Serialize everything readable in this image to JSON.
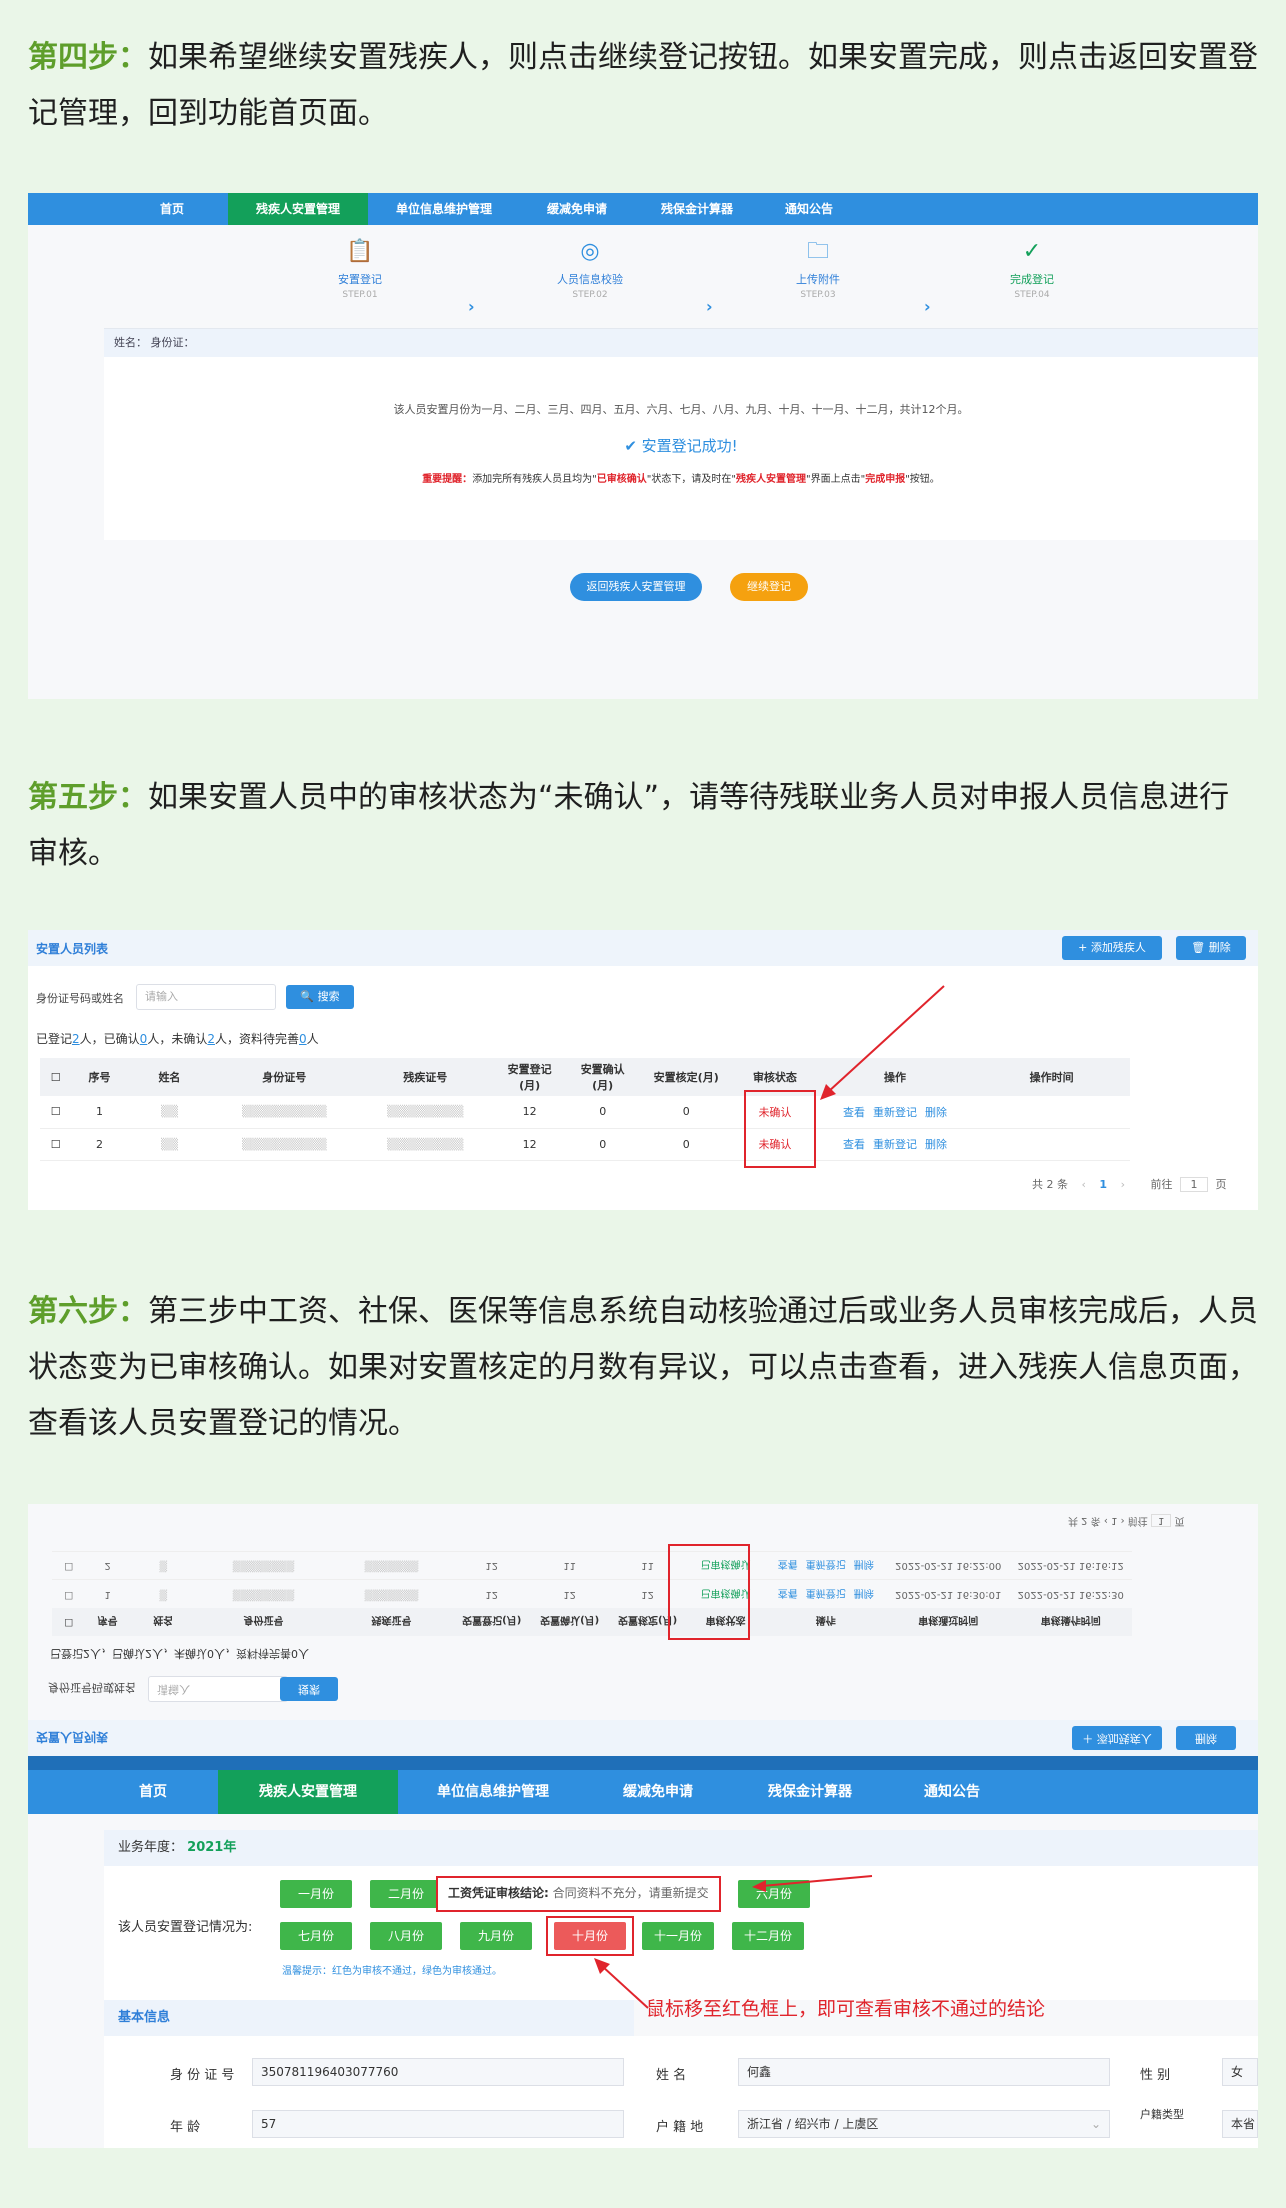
{
  "step4": {
    "label": "第四步：",
    "text": "如果希望继续安置残疾人，则点击继续登记按钮。如果安置完成，则点击返回安置登记管理，回到功能首页面。"
  },
  "nav": [
    "首页",
    "残疾人安置管理",
    "单位信息维护管理",
    "缓减免申请",
    "残保金计算器",
    "通知公告"
  ],
  "wizard": [
    {
      "name": "安置登记",
      "sub": "STEP.01",
      "icon": "clipboard-icon"
    },
    {
      "name": "人员信息校验",
      "sub": "STEP.02",
      "icon": "verify-icon"
    },
    {
      "name": "上传附件",
      "sub": "STEP.03",
      "icon": "upload-folder-icon"
    },
    {
      "name": "完成登记",
      "sub": "STEP.04",
      "icon": "check-circle-icon"
    }
  ],
  "success_card": {
    "person_header": "姓名：        身份证：",
    "months_msg": "该人员安置月份为一月、二月、三月、四月、五月、六月、七月、八月、九月、十月、十一月、十二月，共计12个月。",
    "success": "安置登记成功!",
    "warn_prefix": "重要提醒：",
    "warn_a": "添加完所有残疾人员且均为\"",
    "warn_b": "已审核确认",
    "warn_c": "\"状态下，请及时在\"",
    "warn_d": "残疾人安置管理",
    "warn_e": "\"界面上点击\"",
    "warn_f": "完成申报",
    "warn_g": "\"按钮。"
  },
  "buttons": {
    "back": "返回残疾人安置管理",
    "continue": "继续登记"
  },
  "step5": {
    "label": "第五步：",
    "text": "如果安置人员中的审核状态为“未确认”，请等待残联业务人员对申报人员信息进行审核。"
  },
  "list": {
    "title": "安置人员列表",
    "add": "+ 添加残疾人",
    "delete": "🗑 删除",
    "search_label": "身份证号码或姓名",
    "search_placeholder": "请输入",
    "search_btn": "🔍 搜索",
    "summary": {
      "a": "已登记",
      "registered": "2",
      "b": "人，已确认",
      "confirmed": "0",
      "c": "人，未确认",
      "unconfirmed": "2",
      "d": "人，资料待完善",
      "pending": "0",
      "e": "人"
    },
    "columns": [
      "序号",
      "姓名",
      "身份证号",
      "残疾证号",
      "安置登记\n(月)",
      "安置确认\n(月)",
      "安置核定(月)",
      "审核状态",
      "操作",
      "操作时间"
    ],
    "rows": [
      {
        "no": "1",
        "reg": "12",
        "conf": "0",
        "appr": "0",
        "status": "未确认"
      },
      {
        "no": "2",
        "reg": "12",
        "conf": "0",
        "appr": "0",
        "status": "未确认"
      }
    ],
    "ops": [
      "查看",
      "重新登记",
      "删除"
    ],
    "pager": {
      "total": "共 2 条",
      "page": "1",
      "goto": "前往",
      "pageinput": "1",
      "unit": "页"
    }
  },
  "step6": {
    "label": "第六步：",
    "text": "第三步中工资、社保、医保等信息系统自动核验通过后或业务人员审核完成后，人员状态变为已审核确认。如果对安置核定的月数有异议，可以点击查看，进入残疾人信息页面，查看该人员安置登记的情况。"
  },
  "flipped": {
    "title": "安置人员列表",
    "summary": "已登记2人，已确认2人，未确认0人，资料待完善0人",
    "search_label": "身份证号码或姓名",
    "rows": [
      {
        "no": "1",
        "reg": "12",
        "conf": "12",
        "appr": "12",
        "status": "已审核确认",
        "t1": "2022-02-21 16:30:01",
        "t2": "2022-02-21 16:22:30"
      },
      {
        "no": "2",
        "reg": "12",
        "conf": "11",
        "appr": "11",
        "status": "已审核确认",
        "t1": "2022-02-21 16:22:00",
        "t2": "2022-02-21 16:16:12"
      }
    ],
    "columns": [
      "序号",
      "姓名",
      "身份证号",
      "残疾证号",
      "安置登记(月)",
      "安置确认(月)",
      "安置核定(月)",
      "审核状态",
      "操作",
      "审核通过时间",
      "审核操作时间"
    ]
  },
  "detail": {
    "year_label": "业务年度：",
    "year": "2021年",
    "situation_label": "该人员安置登记情况为:",
    "months_row1": [
      "一月份",
      "二月份",
      "",
      "",
      "",
      "六月份"
    ],
    "months_row2": [
      "七月份",
      "八月份",
      "九月份",
      "十月份",
      "十一月份",
      "十二月份"
    ],
    "tip_label": "工资凭证审核结论:",
    "tip_text": "合同资料不充分，请重新提交",
    "hint": "温馨提示：红色为审核不通过，绿色为审核通过。",
    "annotation": "鼠标移至红色框上，即可查看审核不通过的结论",
    "section": "基本信息",
    "id_label": "身 份 证 号",
    "id_value": "350781196403077760",
    "name_label": "姓 名",
    "name_value": "何鑫",
    "sex_label": "性 别",
    "sex_value": "女",
    "age_label": "年 龄",
    "age_value": "57",
    "hukou_label": "户 籍 地",
    "hukou_value": "浙江省 / 绍兴市 / 上虞区",
    "hukou_type_label": "户籍类型",
    "hukou_type_value": "本省"
  },
  "colors": {
    "accent": "#2f8fdf",
    "active_nav": "#13a05a",
    "error": "#e0242c",
    "step_label": "#5e9e2b",
    "pass": "#3fb64a",
    "fail": "#ec5a5a"
  }
}
